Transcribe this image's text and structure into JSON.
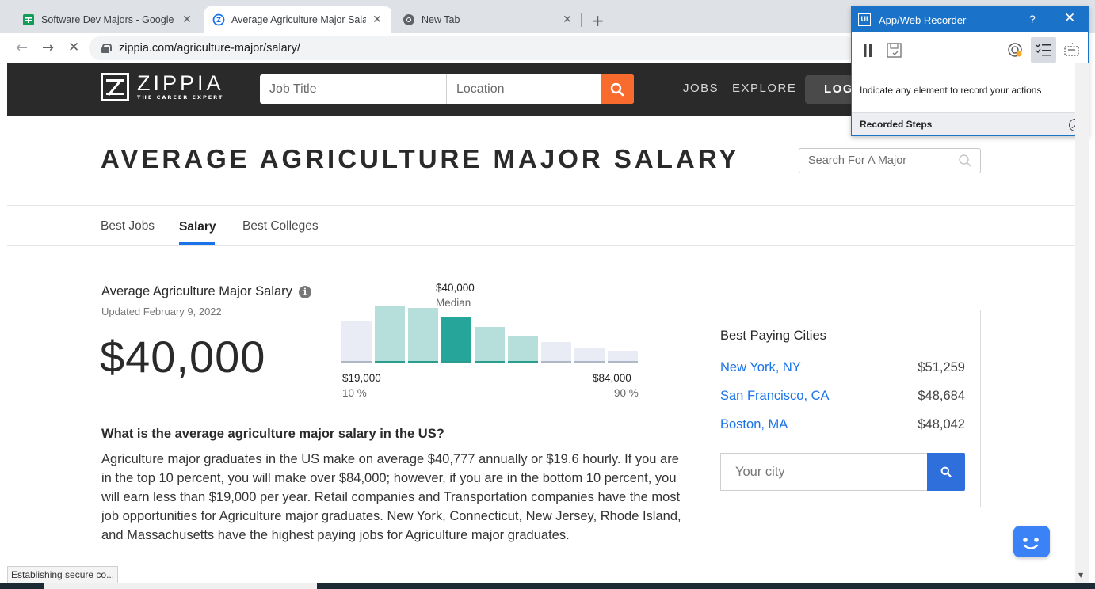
{
  "browser": {
    "tabs": [
      {
        "label": "Software Dev Majors - Google Sh",
        "icon": "google-sheets-icon"
      },
      {
        "label": "Average Agriculture Major Salary",
        "icon": "zippia-favicon-icon"
      },
      {
        "label": "New Tab",
        "icon": "chrome-icon"
      }
    ],
    "url": "zippia.com/agriculture-major/salary/",
    "status_text": "Establishing secure co..."
  },
  "site": {
    "logo_name": "ZIPPIA",
    "logo_tagline": "THE CAREER EXPERT",
    "job_title_placeholder": "Job Title",
    "location_placeholder": "Location",
    "nav": [
      "JOBS",
      "EXPLORE"
    ],
    "login_label": "LOG"
  },
  "page": {
    "title": "AVERAGE AGRICULTURE MAJOR SALARY",
    "major_search_placeholder": "Search For A Major",
    "tabs": [
      "Best Jobs",
      "Salary",
      "Best Colleges"
    ],
    "active_tab": "Salary"
  },
  "salary": {
    "heading": "Average Agriculture Major Salary",
    "updated": "Updated February 9, 2022",
    "big_value": "$40,000",
    "median_value": "$40,000",
    "median_label": "Median",
    "low_value": "$19,000",
    "low_pct": "10 %",
    "high_value": "$84,000",
    "high_pct": "90 %"
  },
  "chart_data": {
    "type": "bar",
    "values": [
      54,
      73,
      70,
      59,
      46,
      35,
      27,
      20,
      16
    ],
    "highlight_index": 3,
    "colors": {
      "outer": "#e9ecf4",
      "inner": "#b6dfdc",
      "median": "#26a69a",
      "base_outer": "#b0b8c8",
      "base_inner": "#2a9d8f"
    }
  },
  "question": {
    "title": "What is the average agriculture major salary in the US?",
    "text": "Agriculture major graduates in the US make on average $40,777 annually or $19.6 hourly. If you are in the top 10 percent, you will make over $84,000; however, if you are in the bottom 10 percent, you will earn less than $19,000 per year. Retail companies and Transportation companies have the most job opportunities for Agriculture major graduates. New York, Connecticut, New Jersey, Rhode Island, and Massachusetts have the highest paying jobs for Agriculture major graduates."
  },
  "cities": {
    "title": "Best Paying Cities",
    "rows": [
      {
        "name": "New York, NY",
        "value": "$51,259"
      },
      {
        "name": "San Francisco, CA",
        "value": "$48,684"
      },
      {
        "name": "Boston, MA",
        "value": "$48,042"
      }
    ],
    "search_placeholder": "Your city"
  },
  "recorder": {
    "title": "App/Web Recorder",
    "help": "?",
    "message": "Indicate any element to record your actions",
    "steps_label": "Recorded Steps",
    "logo": "Ui"
  },
  "colors": {
    "accent_orange": "#f96a2d",
    "link_blue": "#1a73e8",
    "header_dark": "#2a2a2a",
    "recorder_blue": "#1a73c9"
  }
}
